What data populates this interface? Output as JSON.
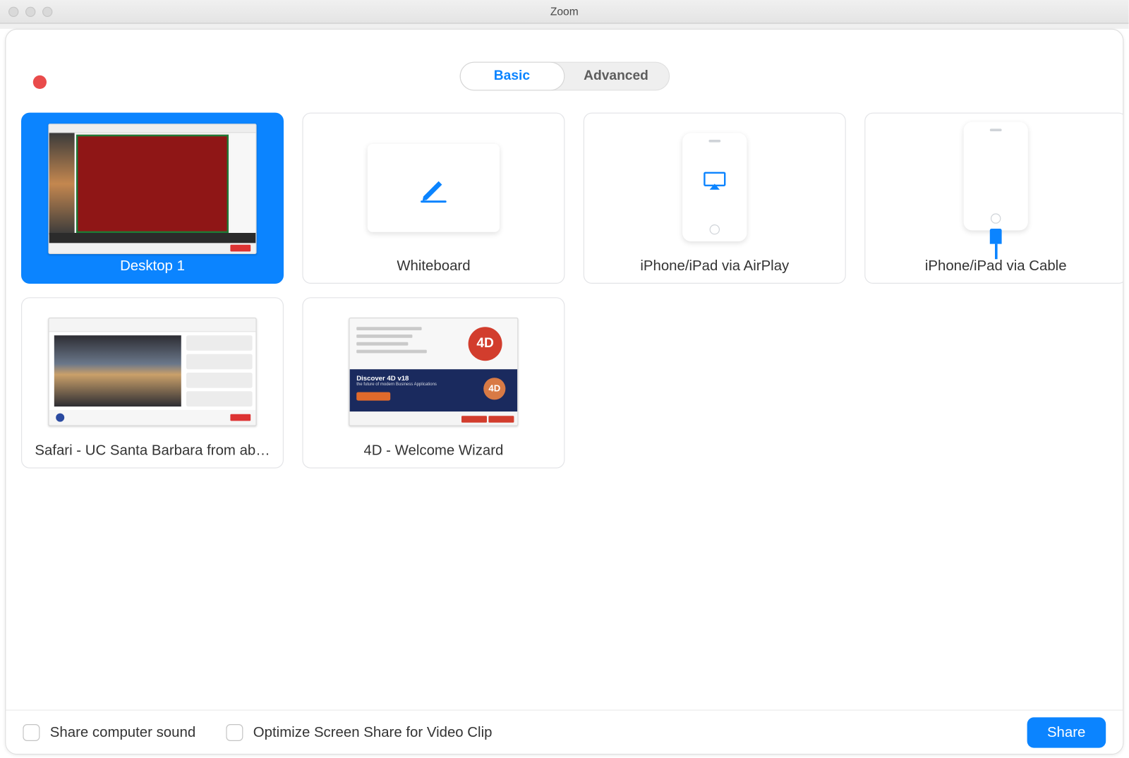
{
  "window": {
    "title": "Zoom"
  },
  "tabs": {
    "basic": "Basic",
    "advanced": "Advanced",
    "active": "basic"
  },
  "tiles": {
    "desktop1": "Desktop 1",
    "whiteboard": "Whiteboard",
    "airplay": "iPhone/iPad via AirPlay",
    "cable": "iPhone/iPad via Cable",
    "safari": "Safari - UC Santa Barbara from ab…",
    "fourd": "4D - Welcome Wizard"
  },
  "fourd_content": {
    "logo_text": "4D",
    "banner_title": "Discover 4D v18",
    "banner_sub": "the future of modern Business Applications"
  },
  "bottom": {
    "share_sound": "Share computer sound",
    "optimize": "Optimize Screen Share for Video Clip",
    "share_btn": "Share"
  }
}
